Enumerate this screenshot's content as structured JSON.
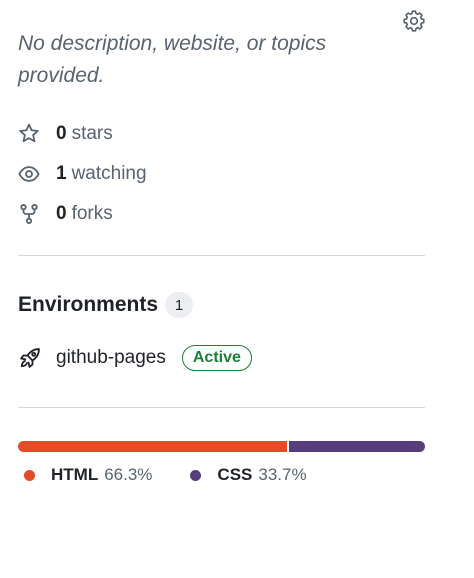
{
  "about": {
    "description": "No description, website, or topics provided."
  },
  "stats": [
    {
      "icon": "star-icon",
      "count": "0",
      "label": "stars"
    },
    {
      "icon": "eye-icon",
      "count": "1",
      "label": "watching"
    },
    {
      "icon": "fork-icon",
      "count": "0",
      "label": "forks"
    }
  ],
  "environments": {
    "title": "Environments",
    "count": "1",
    "items": [
      {
        "icon": "rocket-icon",
        "name": "github-pages",
        "status": "Active"
      }
    ]
  },
  "languages": {
    "items": [
      {
        "name": "HTML",
        "percent_label": "66.3%",
        "percent": 66.3,
        "color": "#e34c26"
      },
      {
        "name": "CSS",
        "percent_label": "33.7%",
        "percent": 33.7,
        "color": "#563d7c"
      }
    ]
  },
  "colors": {
    "success": "#1a7f37",
    "muted_text": "#59636e",
    "border": "#d1d9e0"
  }
}
